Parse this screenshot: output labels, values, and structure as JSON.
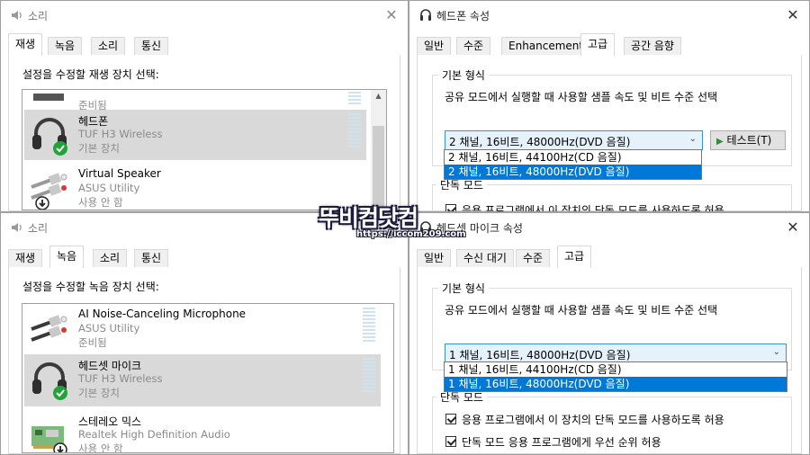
{
  "sound_playback": {
    "title": "소리",
    "close": "✕",
    "tabs": [
      "재생",
      "녹음",
      "소리",
      "통신"
    ],
    "active_tab": 0,
    "prompt": "설정을 수정할 재생 장치 선택:",
    "devices": [
      {
        "name": "",
        "sub": "",
        "status": "준비됨",
        "icon": "monitor-icon"
      },
      {
        "name": "헤드폰",
        "sub": "TUF H3 Wireless",
        "status": "기본 장치",
        "icon": "headset-icon",
        "badge": "check-badge",
        "selected": true
      },
      {
        "name": "Virtual Speaker",
        "sub": "ASUS Utility",
        "status": "사용 안 함",
        "icon": "audio-cable-icon",
        "badge": "disabled-badge"
      }
    ]
  },
  "sound_recording": {
    "title": "소리",
    "close": "✕",
    "tabs": [
      "재생",
      "녹음",
      "소리",
      "통신"
    ],
    "active_tab": 1,
    "prompt": "설정을 수정할 녹음 장치 선택:",
    "devices": [
      {
        "name": "AI Noise-Canceling Microphone",
        "sub": "ASUS Utility",
        "status": "준비됨",
        "icon": "audio-cable-icon"
      },
      {
        "name": "헤드셋 마이크",
        "sub": "TUF H3 Wireless",
        "status": "기본 장치",
        "icon": "headset-icon",
        "badge": "check-badge",
        "selected": true
      },
      {
        "name": "스테레오 믹스",
        "sub": "Realtek High Definition Audio",
        "status": "사용 안 함",
        "icon": "sound-card-icon",
        "badge": "disabled-badge"
      }
    ]
  },
  "headphone_props": {
    "title": "헤드폰 속성",
    "close": "✕",
    "tabs": [
      "일반",
      "수준",
      "Enhancements",
      "고급",
      "공간 음향"
    ],
    "active_tab": 3,
    "default_format_group": "기본 형식",
    "format_desc": "공유 모드에서 실행할 때 사용할 샘플 속도 및 비트 수준 선택",
    "combo_value": "2 채널, 16비트, 48000Hz(DVD 음질)",
    "options": [
      "2 채널, 16비트, 44100Hz(CD 음질)",
      "2 채널, 16비트, 48000Hz(DVD 음질)"
    ],
    "highlighted_option": 1,
    "test_button": "테스트(T)",
    "exclusive_group": "단독 모드",
    "exclusive_check1": "응용 프로그램에서 이 장치의 단독 모드를 사용하도록 허용"
  },
  "mic_props": {
    "title": "헤드셋 마이크 속성",
    "close": "✕",
    "tabs": [
      "일반",
      "수신 대기",
      "수준",
      "고급"
    ],
    "active_tab": 3,
    "default_format_group": "기본 형식",
    "format_desc": "공유 모드에서 실행할 때 사용할 샘플 속도 및 비트 수준 선택",
    "combo_value": "1 채널, 16비트, 48000Hz(DVD 음질)",
    "options": [
      "1 채널, 16비트, 44100Hz(CD 음질)",
      "1 채널, 16비트, 48000Hz(DVD 음질)"
    ],
    "highlighted_option": 1,
    "exclusive_group": "단독 모드",
    "exclusive_check1": "응용 프로그램에서 이 장치의 단독 모드를 사용하도록 허용",
    "exclusive_check2": "단독 모드 응용 프로그램에게 우선 순위 허용"
  },
  "watermark": {
    "main": "뚜비컴닷컴",
    "url": "https://iccom209.com"
  },
  "colors": {
    "accent": "#0078d7",
    "combo_bg": "#e5f1fb",
    "combo_border": "#3c8fd8",
    "selected_row": "#d9d9d9",
    "check_green": "#21a33a"
  }
}
